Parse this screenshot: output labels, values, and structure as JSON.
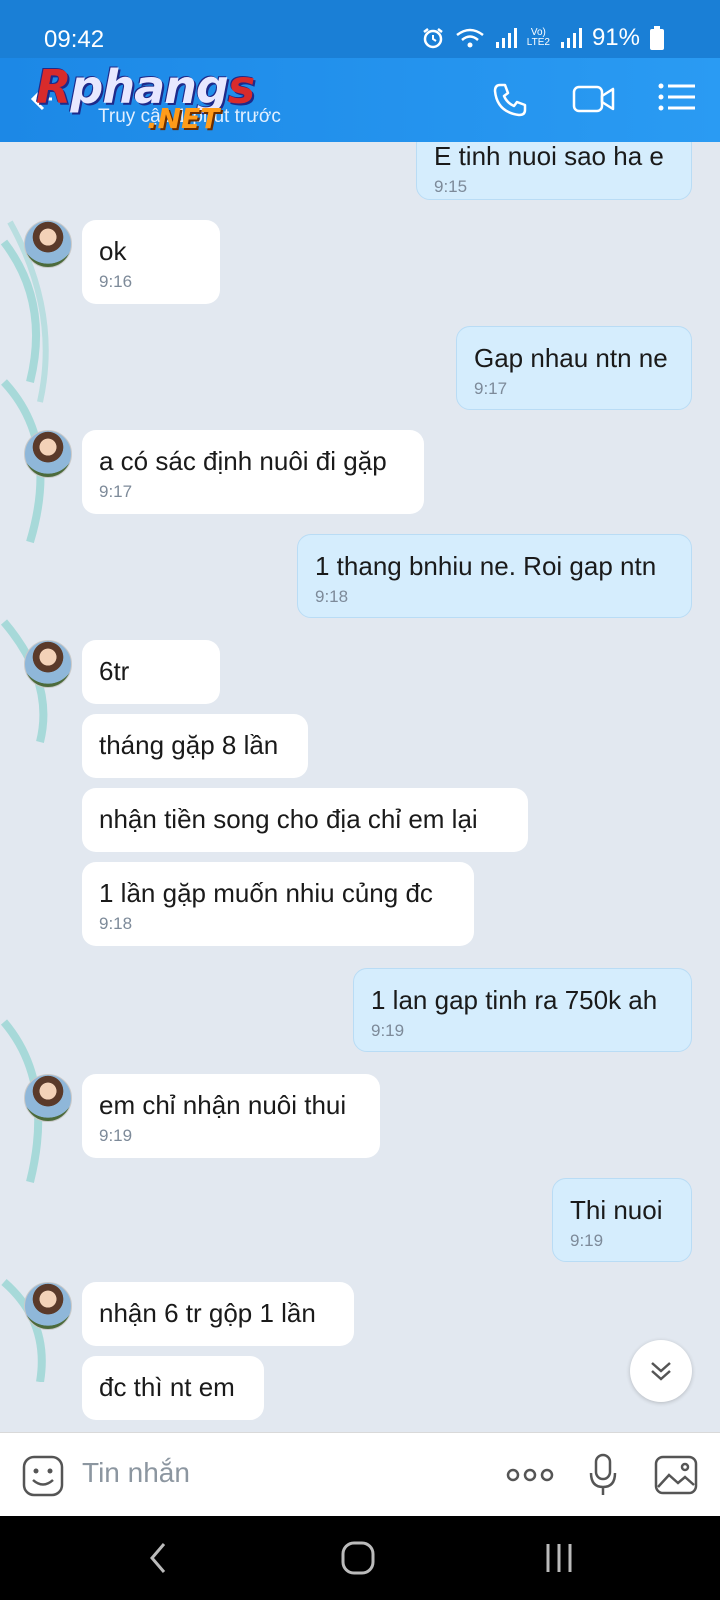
{
  "status_bar": {
    "time": "09:42",
    "network_top": "Vo)",
    "network_bottom": "LTE2",
    "battery": "91%"
  },
  "header": {
    "logo_main": "Rphang",
    "logo_first": "R",
    "logo_mid": "phang",
    "logo_last": "s",
    "logo_suffix": ".NET",
    "subtitle": "Truy cập 1 phút trước",
    "icons": [
      "back-arrow-icon",
      "phone-icon",
      "video-call-icon",
      "menu-list-icon"
    ]
  },
  "messages": [
    {
      "dir": "out",
      "text": "E tinh nuoi sao ha e",
      "time": "9:15"
    },
    {
      "dir": "in",
      "text": "ok",
      "time": "9:16"
    },
    {
      "dir": "out",
      "text": "Gap nhau ntn ne",
      "time": "9:17"
    },
    {
      "dir": "in",
      "text": "a có sác định nuôi đi gặp",
      "time": "9:17"
    },
    {
      "dir": "out",
      "text": "1 thang bnhiu ne. Roi gap ntn",
      "time": "9:18"
    },
    {
      "dir": "in",
      "text": "6tr",
      "time": ""
    },
    {
      "dir": "in",
      "text": "tháng gặp 8 lần",
      "time": ""
    },
    {
      "dir": "in",
      "text": "nhận tiền song cho địa chỉ em lại",
      "time": ""
    },
    {
      "dir": "in",
      "text": "1 lần gặp muốn nhiu củng đc",
      "time": "9:18"
    },
    {
      "dir": "out",
      "text": "1 lan gap tinh ra 750k ah",
      "time": "9:19"
    },
    {
      "dir": "in",
      "text": "em chỉ nhận nuôi thui",
      "time": "9:19"
    },
    {
      "dir": "out",
      "text": "Thi nuoi",
      "time": "9:19"
    },
    {
      "dir": "in",
      "text": "nhận 6 tr gộp 1 lần",
      "time": ""
    },
    {
      "dir": "in",
      "text": "đc thì nt em",
      "time": ""
    }
  ],
  "input": {
    "placeholder": "Tin nhắn",
    "icons": [
      "emoji-icon",
      "more-icon",
      "microphone-icon",
      "image-icon"
    ]
  },
  "nav": {
    "icons": [
      "nav-back-icon",
      "nav-home-icon",
      "nav-recents-icon"
    ]
  },
  "colors": {
    "header": "#1c88e6",
    "chat_background": "#e2e8f0",
    "outgoing_bubble": "#d5edfd",
    "incoming_bubble": "#ffffff"
  }
}
